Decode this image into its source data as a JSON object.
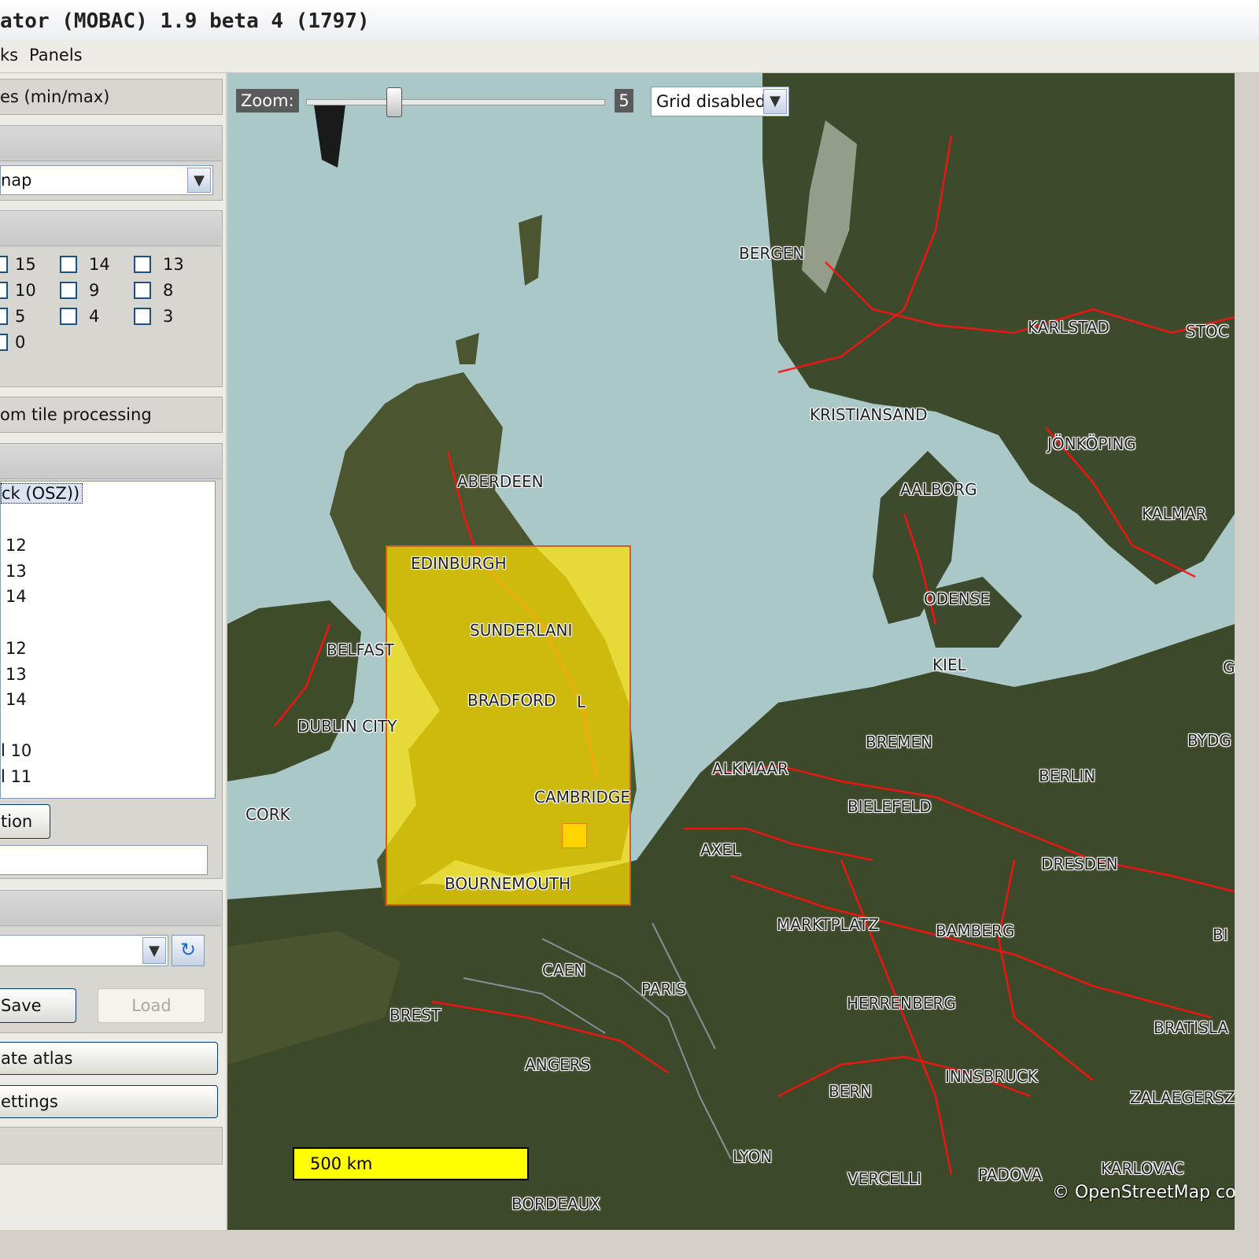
{
  "window": {
    "title": "ator (MOBAC) 1.9 beta 4 (1797)"
  },
  "menu": {
    "items": [
      "ks",
      "Panels"
    ]
  },
  "left": {
    "zoom_section": "es (min/max)",
    "mapsource_value": "nap",
    "zoom_levels": [
      {
        "label": "15"
      },
      {
        "label": "14"
      },
      {
        "label": "13"
      },
      {
        "label": "10"
      },
      {
        "label": "9"
      },
      {
        "label": "8"
      },
      {
        "label": "5"
      },
      {
        "label": "4"
      },
      {
        "label": "3"
      },
      {
        "label": "0"
      }
    ],
    "tile_processing": "om tile processing",
    "list_items": {
      "selected": "ck (OSZ))",
      "l12a": "12",
      "l13a": "13",
      "l14a": "14",
      "l12b": "12",
      "l13b": "13",
      "l14b": "14",
      "l10": "l 10",
      "l11": "l 11"
    },
    "selection_btn": "tion",
    "save_btn": "Save",
    "load_btn": "Load",
    "create_atlas": "ate atlas",
    "settings": "ettings"
  },
  "map": {
    "zoom_label": "Zoom:",
    "zoom_value": "5",
    "zoom_level": 5,
    "grid_select": "Grid disabled",
    "scale": "500 km",
    "attribution": "© OpenStreetMap co",
    "cities": {
      "bergen": "BERGEN",
      "karlstad": "KARLSTAD",
      "stoc": "STOC",
      "kristiansand": "KRISTIANSAND",
      "jonkoping": "JÖNKÖPING",
      "aberdeen": "ABERDEEN",
      "aalborg": "AALBORG",
      "kalmar": "KALMAR",
      "edinburgh": "EDINBURGH",
      "odense": "ODENSE",
      "sunderland": "SUNDERLANI",
      "belfast": "BELFAST",
      "kiel": "KIEL",
      "bradford": "BRADFORD",
      "bradford_l": "L",
      "dublin": "DUBLIN CITY",
      "bremen": "BREMEN",
      "bydg": "BYDG",
      "alkmaar": "ALKMAAR",
      "berlin": "BERLIN",
      "cambridge": "CAMBRIDGE",
      "bielefeld": "BIELEFELD",
      "cork": "CORK",
      "axel": "AXEL",
      "dresden": "DRESDEN",
      "bournemouth": "BOURNEMOUTH",
      "marktplatz": "MARKTPLATZ",
      "bamberg": "BAMBERG",
      "bi": "BI",
      "caen": "CAEN",
      "paris": "PARIS",
      "brest": "BREST",
      "herrenberg": "HERRENBERG",
      "bratisla": "BRATISLA",
      "angers": "ANGERS",
      "innsbruck": "INNSBRUCK",
      "bern": "BERN",
      "zalaegersz": "ZALAEGERSZ",
      "lyon": "LYON",
      "karlovac": "KARLOVAC",
      "padova": "PADOVA",
      "vercelli": "VERCELLI",
      "bordeaux": "BORDEAUX",
      "g": "G"
    },
    "colors": {
      "sea": "#aac8c8",
      "land": "#3c4a2c",
      "roads": "#ff1010",
      "selection": "#ffe100"
    }
  }
}
